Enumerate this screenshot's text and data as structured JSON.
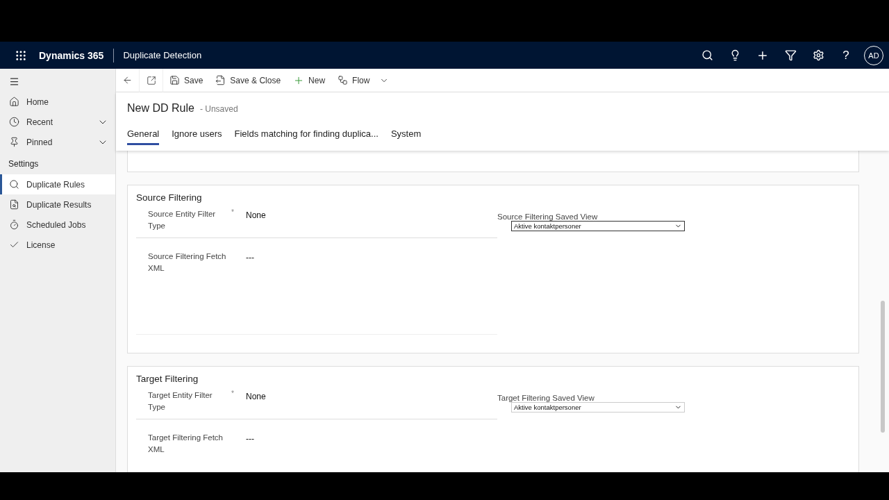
{
  "header": {
    "app_title": "Dynamics 365",
    "area_title": "Duplicate Detection",
    "help": "?",
    "avatar": "AD"
  },
  "sidebar": {
    "nav": [
      {
        "label": "Home",
        "kind": "home"
      },
      {
        "label": "Recent",
        "kind": "recent",
        "expanded": false
      },
      {
        "label": "Pinned",
        "kind": "pinned",
        "expanded": false
      }
    ],
    "group_title": "Settings",
    "items": [
      {
        "label": "Duplicate Rules",
        "kind": "rules",
        "selected": true
      },
      {
        "label": "Duplicate Results",
        "kind": "results",
        "selected": false
      },
      {
        "label": "Scheduled Jobs",
        "kind": "jobs",
        "selected": false
      },
      {
        "label": "License",
        "kind": "license",
        "selected": false
      }
    ]
  },
  "command_bar": [
    {
      "kind": "back"
    },
    {
      "kind": "popout"
    },
    {
      "kind": "save",
      "label": "Save"
    },
    {
      "kind": "save_close",
      "label": "Save & Close"
    },
    {
      "kind": "new",
      "label": "New"
    },
    {
      "kind": "flow",
      "label": "Flow"
    }
  ],
  "record": {
    "title": "New DD Rule",
    "status": "- Unsaved"
  },
  "tabs": [
    {
      "label": "General",
      "selected": true
    },
    {
      "label": "Ignore users",
      "selected": false
    },
    {
      "label": "Fields matching for finding duplica...",
      "selected": false
    },
    {
      "label": "System",
      "selected": false
    }
  ],
  "sections": [
    {
      "title": "Source Filtering",
      "fields": [
        {
          "label": "Source Entity Filter Type",
          "required_mark": "*",
          "value": "None"
        },
        {
          "label": "Source Filtering Fetch XML",
          "value": "---"
        }
      ],
      "view": {
        "label": "Source Filtering Saved View",
        "value": "Aktive kontaktpersoner",
        "focused": true
      }
    },
    {
      "title": "Target Filtering",
      "fields": [
        {
          "label": "Target Entity Filter Type",
          "required_mark": "*",
          "value": "None"
        },
        {
          "label": "Target Filtering Fetch XML",
          "value": "---"
        }
      ],
      "view": {
        "label": "Target Filtering Saved View",
        "value": "Aktive kontaktpersoner",
        "focused": false
      }
    }
  ]
}
